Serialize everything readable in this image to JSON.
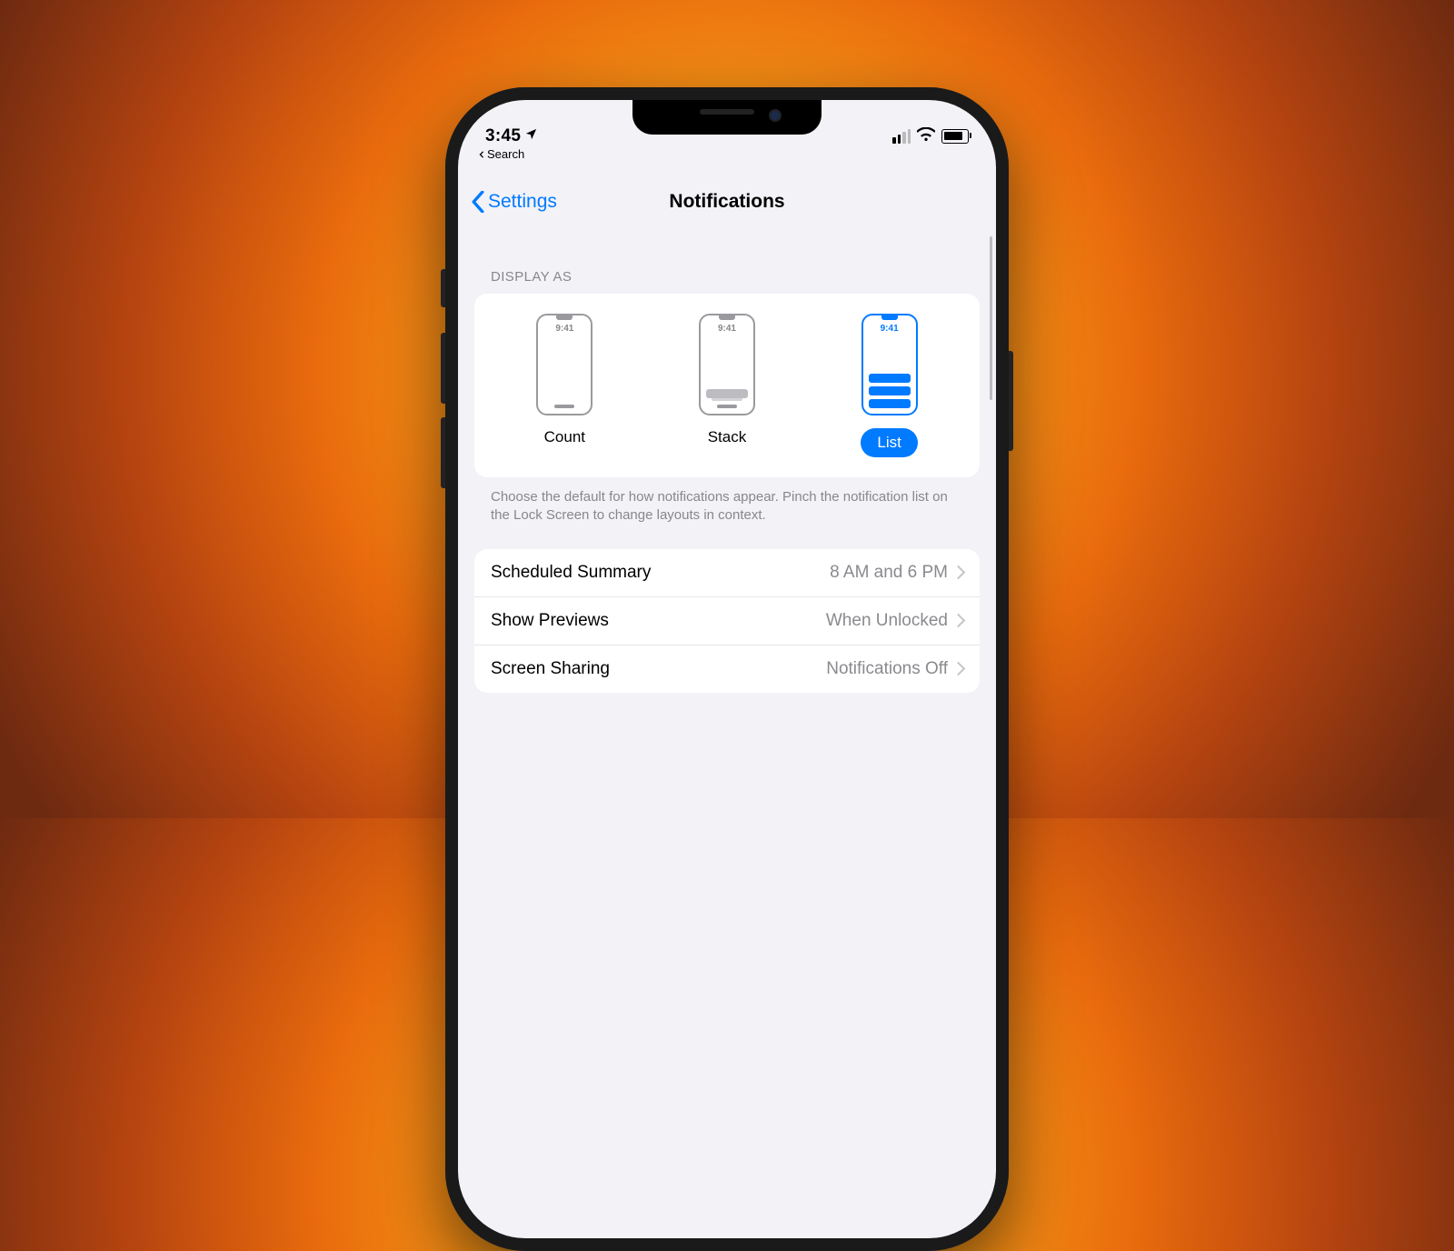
{
  "status": {
    "time": "3:45",
    "breadcrumb": "Search"
  },
  "nav": {
    "back": "Settings",
    "title": "Notifications"
  },
  "display_as": {
    "header": "DISPLAY AS",
    "options": [
      {
        "label": "Count",
        "time": "9:41",
        "selected": false
      },
      {
        "label": "Stack",
        "time": "9:41",
        "selected": false
      },
      {
        "label": "List",
        "time": "9:41",
        "selected": true
      }
    ],
    "footer": "Choose the default for how notifications appear. Pinch the notification list on the Lock Screen to change layouts in context."
  },
  "rows": [
    {
      "label": "Scheduled Summary",
      "value": "8 AM and 6 PM"
    },
    {
      "label": "Show Previews",
      "value": "When Unlocked"
    },
    {
      "label": "Screen Sharing",
      "value": "Notifications Off"
    }
  ],
  "colors": {
    "accent": "#007aff"
  }
}
